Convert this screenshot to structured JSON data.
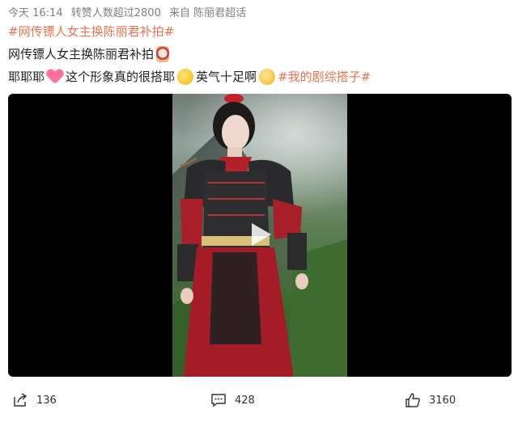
{
  "meta": {
    "time": "今天 16:14",
    "reposts": "转赞人数超过2800",
    "source": "来自 陈丽君超话"
  },
  "post": {
    "topic_tag": "#网传镖人女主换陈丽君补拍#",
    "line1_text": "网传镖人女主换陈丽君补拍",
    "line2_part1": "耶耶耶",
    "line2_part2": "这个形象真的很搭耶",
    "line2_part3": "英气十足啊",
    "line2_tag": "#我的剧综搭子#"
  },
  "actions": {
    "share_count": "136",
    "comment_count": "428",
    "like_count": "3160"
  },
  "icons": {
    "share": "share-icon",
    "comment": "comment-icon",
    "like": "thumbs-up-icon",
    "play": "play-icon"
  },
  "colors": {
    "topic": "#eb7350",
    "meta_text": "#808080",
    "video_bg": "#000000"
  }
}
